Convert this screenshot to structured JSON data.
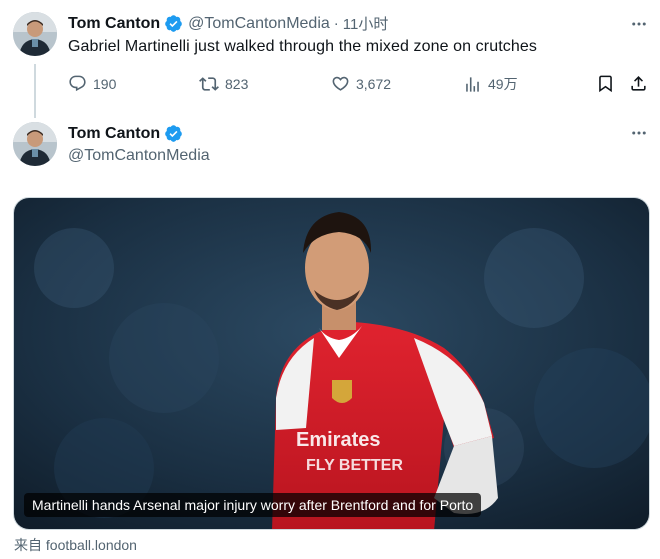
{
  "tweet": {
    "author": {
      "name": "Tom Canton",
      "handle": "@TomCantonMedia",
      "verified": true
    },
    "time": "11小时",
    "text": "Gabriel Martinelli just walked through the mixed zone on crutches",
    "actions": {
      "replies": "190",
      "retweets": "823",
      "likes": "3,672",
      "views": "49万"
    }
  },
  "reply": {
    "author": {
      "name": "Tom Canton",
      "handle": "@TomCantonMedia",
      "verified": true
    },
    "card": {
      "headline": "Martinelli hands Arsenal major injury worry after Brentford and for Porto",
      "source": "来自 football.london"
    }
  },
  "colors": {
    "accent": "#1d9bf0",
    "muted": "#536471",
    "text": "#0f1419",
    "kit_red": "#d5202e"
  },
  "icons": [
    "reply-icon",
    "retweet-icon",
    "like-icon",
    "views-icon",
    "bookmark-icon",
    "share-icon",
    "more-icon",
    "verified-icon"
  ]
}
